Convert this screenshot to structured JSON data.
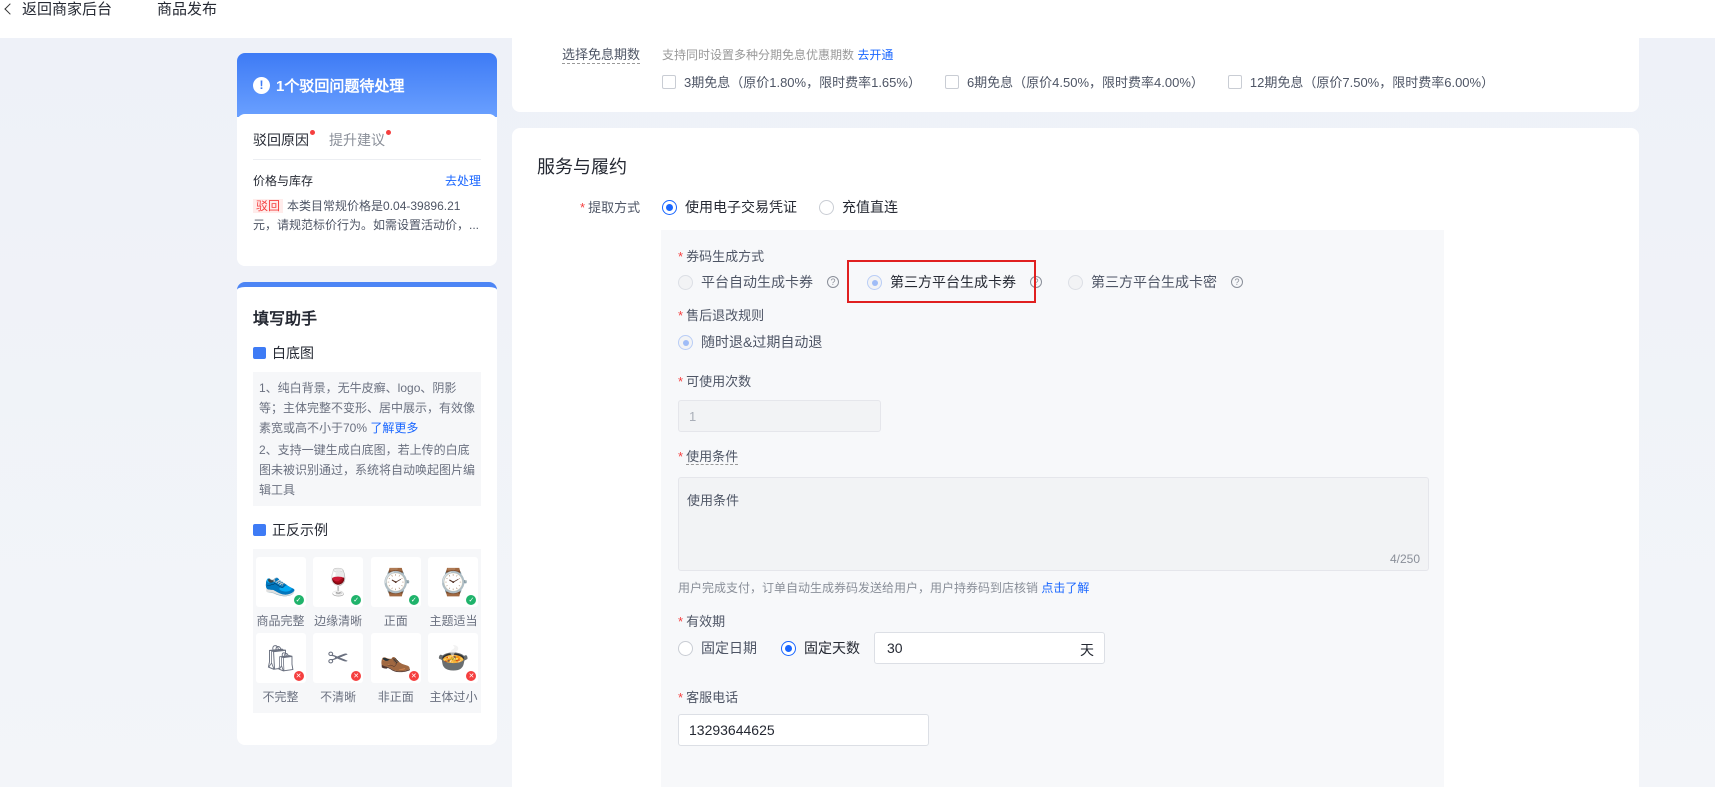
{
  "topbar": {
    "back_label": "返回商家后台",
    "title": "商品发布"
  },
  "rejection": {
    "header": "1个驳回问题待处理",
    "tabs": [
      "驳回原因",
      "提升建议"
    ],
    "item_title": "价格与库存",
    "item_action": "去处理",
    "tag": "驳回",
    "text": "本类目常规价格是0.04-39896.21元，请规范标价行为。如需设置活动价，..."
  },
  "helper": {
    "title": "填写助手",
    "white_bg": {
      "title": "白底图",
      "tip1": "1、纯白背景，无牛皮癣、logo、阴影等；主体完整不变形、居中展示，有效像素宽或高不小于70%",
      "tip1_link": "了解更多",
      "tip2": "2、支持一键生成白底图，若上传的白底图未被识别通过，系统将自动唤起图片编辑工具"
    },
    "examples": {
      "title": "正反示例",
      "items": [
        {
          "label": "商品完整",
          "icon": "sneaker-icon",
          "glyph": "👟",
          "ok": true
        },
        {
          "label": "边缘清晰",
          "icon": "bottle-icon",
          "glyph": "🍷",
          "ok": true
        },
        {
          "label": "正面",
          "icon": "watch-icon",
          "glyph": "⌚",
          "ok": true
        },
        {
          "label": "主题适当",
          "icon": "band-icon",
          "glyph": "⌚",
          "ok": true
        },
        {
          "label": "不完整",
          "icon": "bag-icon",
          "glyph": "🛍",
          "ok": false
        },
        {
          "label": "不清晰",
          "icon": "scissors-icon",
          "glyph": "✂",
          "ok": false
        },
        {
          "label": "非正面",
          "icon": "shoe-icon",
          "glyph": "👞",
          "ok": false
        },
        {
          "label": "主体过小",
          "icon": "cooker-icon",
          "glyph": "🍲",
          "ok": false
        }
      ]
    }
  },
  "installment": {
    "label": "选择免息期数",
    "note": "支持同时设置多种分期免息优惠期数",
    "note_link": "去开通",
    "options": [
      "3期免息（原价1.80%，限时费率1.65%）",
      "6期免息（原价4.50%，限时费率4.00%）",
      "12期免息（原价7.50%，限时费率6.00%）"
    ]
  },
  "service": {
    "title": "服务与履约",
    "fetch": {
      "label": "提取方式",
      "options": [
        "使用电子交易凭证",
        "充值直连"
      ],
      "selected": 0
    },
    "code_gen": {
      "label": "券码生成方式",
      "options": [
        "平台自动生成卡券",
        "第三方平台生成卡券",
        "第三方平台生成卡密"
      ],
      "selected": 1
    },
    "after_sale": {
      "label": "售后退改规则",
      "option": "随时退&过期自动退"
    },
    "usage_count": {
      "label": "可使用次数",
      "value": "1"
    },
    "conditions": {
      "label": "使用条件",
      "value": "使用条件",
      "count": "4/250"
    },
    "hint": {
      "text": "用户完成支付，订单自动生成券码发送给用户，用户持券码到店核销",
      "link": "点击了解"
    },
    "validity": {
      "label": "有效期",
      "options": [
        "固定日期",
        "固定天数"
      ],
      "selected": 1,
      "days": "30",
      "unit": "天"
    },
    "phone": {
      "label": "客服电话",
      "value": "13293644625"
    }
  }
}
